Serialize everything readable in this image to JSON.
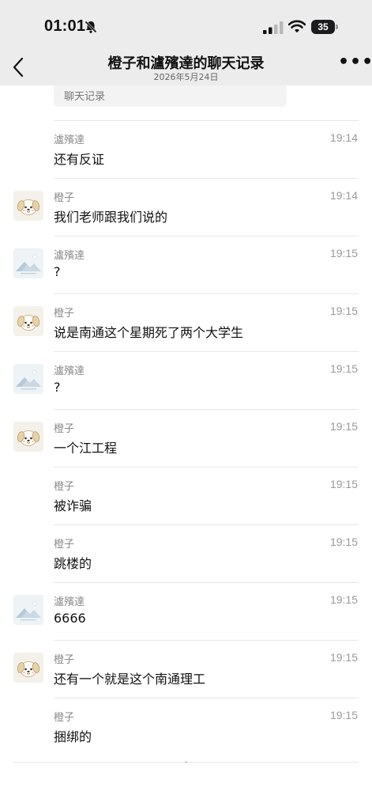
{
  "status_bar": {
    "time": "01:01",
    "battery": "35"
  },
  "nav": {
    "title": "橙子和瀘殯達的聊天记录",
    "subtitle": "2026年5月24日",
    "more": "•••"
  },
  "quoted_card": {
    "label": "聊天记录"
  },
  "messages": [
    {
      "sender": "瀘殯達",
      "time": "19:14",
      "text": "还有反证",
      "avatar": "none"
    },
    {
      "sender": "橙子",
      "time": "19:14",
      "text": "我们老师跟我们说的",
      "avatar": "dog"
    },
    {
      "sender": "瀘殯達",
      "time": "19:15",
      "text": "?",
      "avatar": "landscape"
    },
    {
      "sender": "橙子",
      "time": "19:15",
      "text": "说是南通这个星期死了两个大学生",
      "avatar": "dog"
    },
    {
      "sender": "瀘殯達",
      "time": "19:15",
      "text": "?",
      "avatar": "landscape"
    },
    {
      "sender": "橙子",
      "time": "19:15",
      "text": "一个江工程",
      "avatar": "dog"
    },
    {
      "sender": "橙子",
      "time": "19:15",
      "text": "被诈骗",
      "avatar": "none"
    },
    {
      "sender": "橙子",
      "time": "19:15",
      "text": "跳楼的",
      "avatar": "none"
    },
    {
      "sender": "瀘殯達",
      "time": "19:15",
      "text": "6666",
      "avatar": "landscape"
    },
    {
      "sender": "橙子",
      "time": "19:15",
      "text": "还有一个就是这个南通理工",
      "avatar": "dog"
    },
    {
      "sender": "橙子",
      "time": "19:15",
      "text": "捆绑的",
      "avatar": "none"
    }
  ]
}
